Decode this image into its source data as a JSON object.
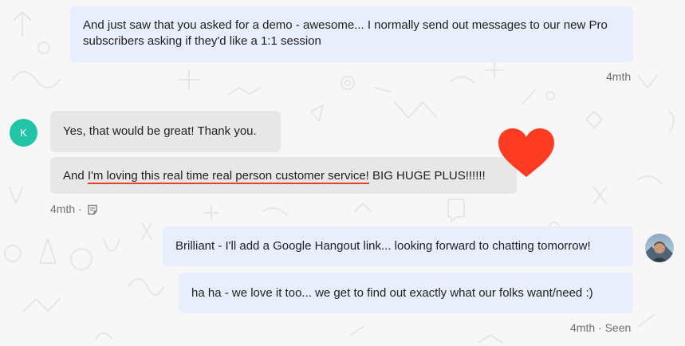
{
  "messages": [
    {
      "text": "And just saw that you asked for a demo - awesome... I normally send out messages to our new Pro subscribers asking if they'd like a 1:1 session",
      "time": "4mth"
    },
    {
      "avatar": "K",
      "text": "Yes, that would be great! Thank you."
    },
    {
      "prefix": "And ",
      "highlight": "I'm loving this real time real person customer service!",
      "suffix": " BIG HUGE PLUS!!!!!!",
      "time": "4mth ·",
      "reaction": "heart-icon"
    },
    {
      "text": "Brilliant - I'll add a Google Hangout link... looking forward to chatting tomorrow!"
    },
    {
      "text": "ha ha - we love it too... we get to find out exactly what our folks want/need :)",
      "meta": "4mth · Seen"
    }
  ],
  "colors": {
    "outgoing_bubble": "#e9eefd",
    "incoming_bubble": "#e7e7e8",
    "avatar": "#22c4a8",
    "heart": "#ff3b21",
    "underline": "#e3432c",
    "meta_text": "#6f6f74"
  }
}
